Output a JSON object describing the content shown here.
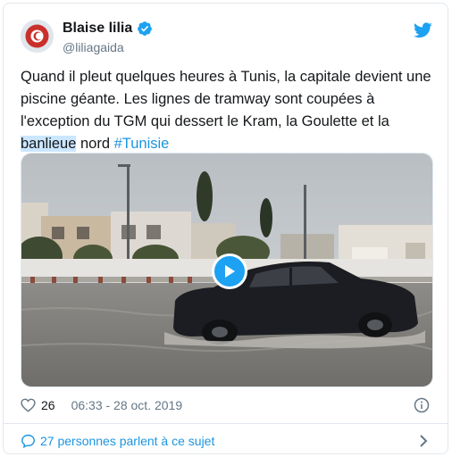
{
  "author": {
    "name": "Blaise lilia",
    "handle": "@liliagaida",
    "verified": true
  },
  "tweet": {
    "text_part1": "Quand il pleut quelques heures à Tunis, la capitale devient une piscine géante. Les lignes de tramway sont coupées à l'exception du TGM qui dessert le Kram, la Goulette et la ",
    "highlighted_word": "banlieue",
    "text_part2": " nord ",
    "hashtag": "#Tunisie"
  },
  "media": {
    "type": "video",
    "icon": "play-icon"
  },
  "meta": {
    "like_count": "26",
    "timestamp": "06:33 - 28 oct. 2019"
  },
  "footer": {
    "conversation_label": "27 personnes parlent à ce sujet"
  },
  "colors": {
    "accent": "#1da1f2",
    "link": "#1b95e0",
    "secondary_text": "#657786",
    "highlight": "#cbe6ff"
  }
}
